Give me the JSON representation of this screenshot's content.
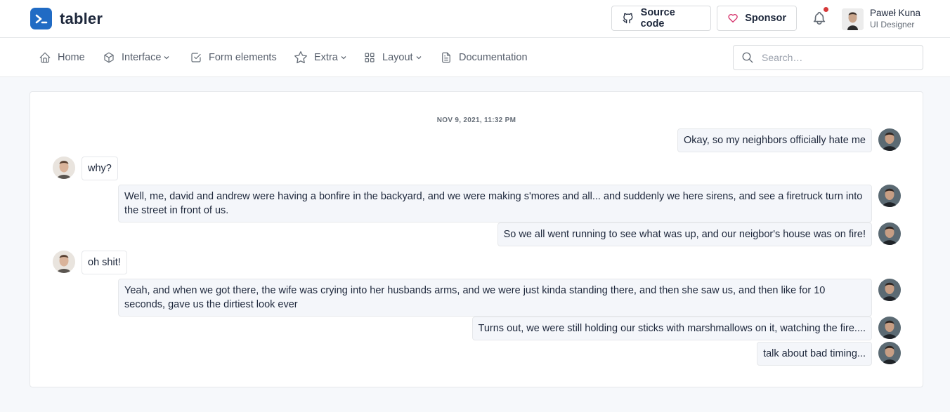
{
  "brand": {
    "name": "tabler",
    "accent": "#206bc4"
  },
  "header": {
    "source_label": "Source code",
    "sponsor_label": "Sponsor",
    "user": {
      "name": "Paweł Kuna",
      "role": "UI Designer"
    }
  },
  "nav": {
    "items": [
      {
        "label": "Home",
        "icon": "home-icon"
      },
      {
        "label": "Interface",
        "icon": "package-icon",
        "dropdown": true
      },
      {
        "label": "Form elements",
        "icon": "checkbox-icon"
      },
      {
        "label": "Extra",
        "icon": "star-icon",
        "dropdown": true
      },
      {
        "label": "Layout",
        "icon": "layout-grid-icon",
        "dropdown": true
      },
      {
        "label": "Documentation",
        "icon": "file-text-icon"
      }
    ],
    "search_placeholder": "Search…"
  },
  "chat": {
    "date": "NOV 9, 2021, 11:32 PM",
    "messages": [
      {
        "from": "me",
        "text": "Okay, so my neighbors officially hate me"
      },
      {
        "from": "them",
        "text": "why?"
      },
      {
        "from": "me",
        "text": "Well, me, david and andrew were having a bonfire in the backyard, and we were making s'mores and all... and suddenly we here sirens, and see a firetruck turn into the street in front of us."
      },
      {
        "from": "me",
        "text": "So we all went running to see what was up, and our neigbor's house was on fire!"
      },
      {
        "from": "them",
        "text": "oh shit!"
      },
      {
        "from": "me",
        "text": "Yeah, and when we got there, the wife was crying into her husbands arms, and we were just kinda standing there, and then she saw us, and then like for 10 seconds, gave us the dirtiest look ever"
      },
      {
        "from": "me",
        "text": "Turns out, we were still holding our sticks with marshmallows on it, watching the fire...."
      },
      {
        "from": "me",
        "text": "talk about bad timing..."
      }
    ]
  }
}
